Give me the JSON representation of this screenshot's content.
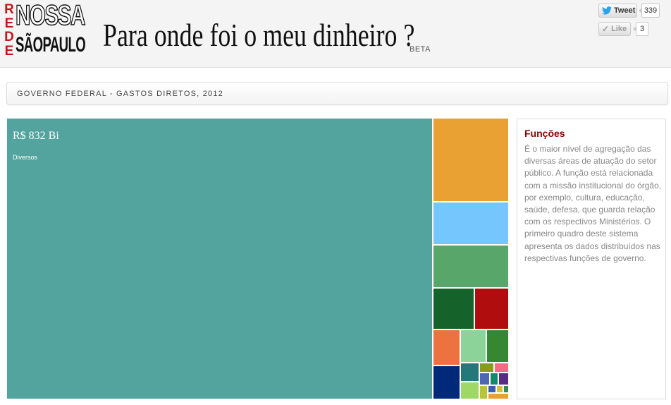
{
  "header": {
    "logo_rede_letters": [
      "R",
      "E",
      "D",
      "E"
    ],
    "logo_nossa": "NOSSA",
    "logo_saopaulo": "SÃOPAULO",
    "title": "Para onde foi o meu dinheiro ?",
    "beta": "BETA",
    "tweet_label": "Tweet",
    "tweet_count": "339",
    "like_label": "Like",
    "like_count": "3"
  },
  "breadcrumb": {
    "text": "GOVERNO FEDERAL - GASTOS DIRETOS, 2012"
  },
  "treemap": {
    "main_value": "R$ 832 Bi",
    "main_label": "Diversos",
    "main_color": "#53a49f",
    "tile_colors": [
      "#e8a132",
      "#75c6fd",
      "#58a66a",
      "#16622b",
      "#b00e0e",
      "#ec7242",
      "#8ad499",
      "#368731",
      "#002a79",
      "#23787a",
      "#9ed966",
      "#8c9a1b",
      "#f5698a",
      "#4f66b5",
      "#148a6a",
      "#5b2c84",
      "#b8c43a",
      "#3b5ea7",
      "#d4c236",
      "#2e8b57"
    ]
  },
  "info": {
    "title": "Funções",
    "text": "É o maior nível de agregação das diversas áreas de atuação do setor público. A função está relacionada com a missão institucional do órgão, por exemplo, cultura, educação, saúde, defesa, que guarda relação com os respectivos Ministérios. O primeiro quadro deste sistema apresenta os dados distribuídos nas respectivas funções de governo."
  }
}
